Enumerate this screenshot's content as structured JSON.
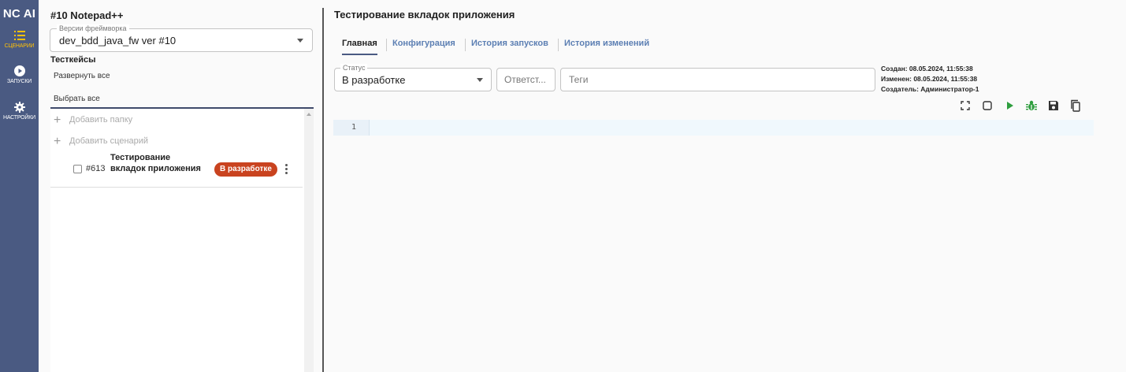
{
  "nav": {
    "logo": "NC AI",
    "items": [
      {
        "label": "СЦЕНАРИИ",
        "icon": "list-icon",
        "active": true
      },
      {
        "label": "ЗАПУСКИ",
        "icon": "play-circle-icon",
        "active": false
      },
      {
        "label": "НАСТРОЙКИ",
        "icon": "gear-icon",
        "active": false
      }
    ]
  },
  "sidebar": {
    "project_title": "#10 Notepad++",
    "framework_select": {
      "legend": "Версии фреймворка",
      "value": "dev_bdd_java_fw ver #10"
    },
    "section_title": "Тесткейсы",
    "expand_all": "Развернуть все",
    "select_all": "Выбрать все",
    "add_folder": "Добавить папку",
    "add_scenario": "Добавить сценарий",
    "cases": [
      {
        "number": "#613",
        "name": "Тестирование вкладок приложения",
        "status": "В разработке"
      }
    ]
  },
  "main": {
    "title": "Тестирование вкладок приложения",
    "tabs": [
      {
        "label": "Главная",
        "active": true
      },
      {
        "label": "Конфигурация",
        "active": false
      },
      {
        "label": "История запусков",
        "active": false
      },
      {
        "label": "История изменений",
        "active": false
      }
    ],
    "status": {
      "legend": "Статус",
      "value": "В разработке"
    },
    "responsible_placeholder": "Ответст...",
    "tags_placeholder": "Теги",
    "meta": {
      "created": "Создан: 08.05.2024, 11:55:38",
      "modified": "Изменен: 08.05.2024, 11:55:38",
      "creator": "Создатель: Администратор-1"
    },
    "editor": {
      "line_numbers": [
        "1"
      ]
    }
  },
  "colors": {
    "nav_bg": "#4a5a82",
    "nav_active": "#ffc107",
    "badge_bg": "#c9431f",
    "tab_link": "#5c7fb3",
    "run_green": "#2e9e3e"
  }
}
